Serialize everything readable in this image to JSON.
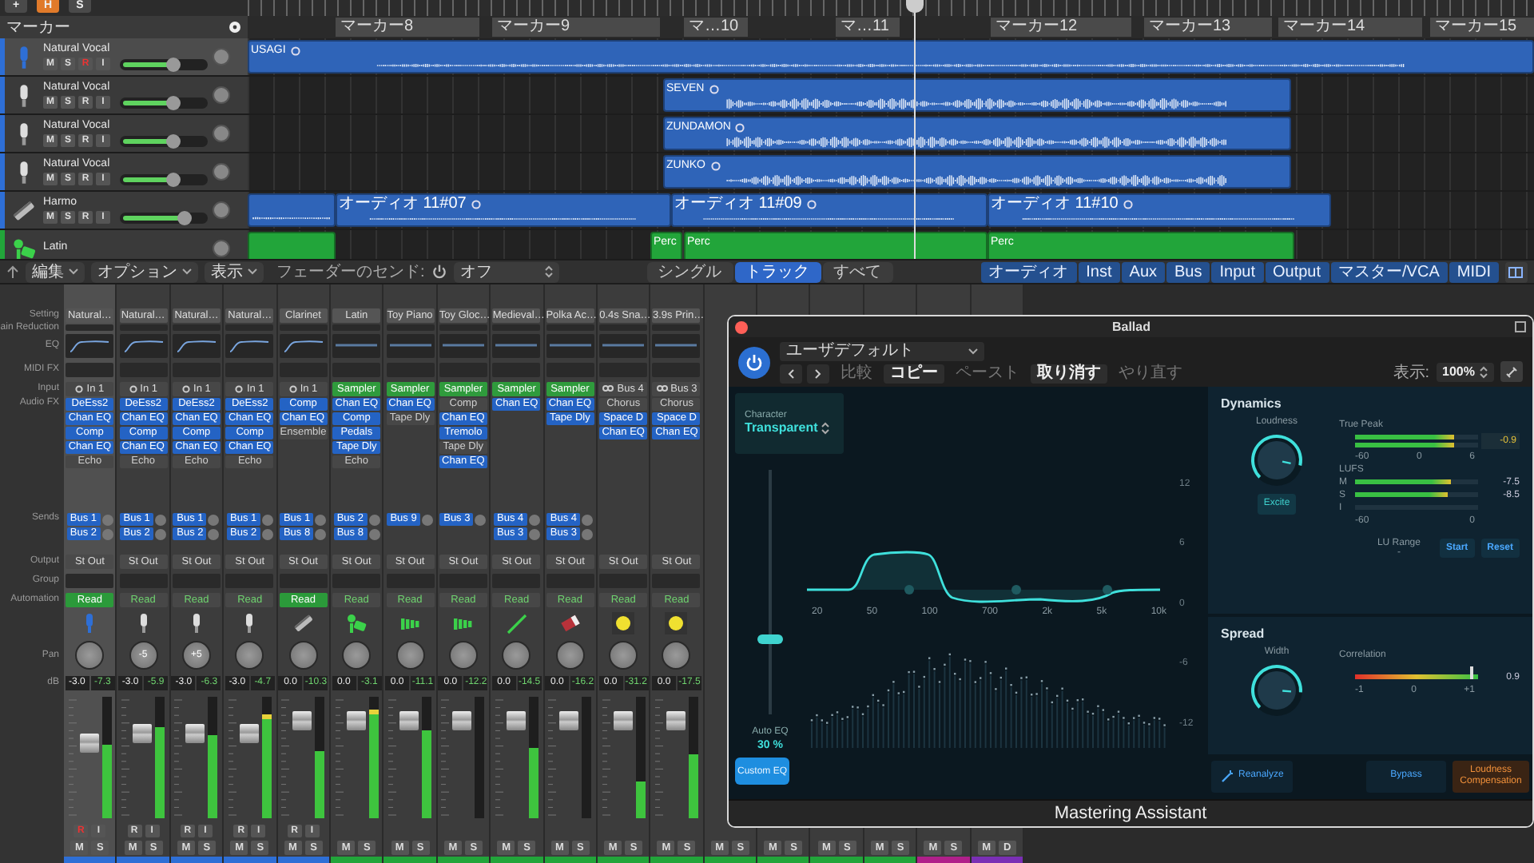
{
  "toolbar": [
    {
      "label": "+",
      "selected": false
    },
    {
      "label": "H",
      "selected": true
    },
    {
      "label": "S",
      "selected": false
    }
  ],
  "markers": {
    "title": "マーカー",
    "items": [
      "マーカー8",
      "マーカー9",
      "マ…10",
      "マ…11",
      "マーカー12",
      "マーカー13",
      "マーカー14",
      "マーカー15"
    ]
  },
  "tracks": [
    {
      "name": "Natural Vocal",
      "kind": "mic-blue",
      "color": "#2e6fd6",
      "selected": true,
      "level": 0.6,
      "buttons": [
        {
          "label": "M",
          "on": false
        },
        {
          "label": "S",
          "on": false
        },
        {
          "label": "R",
          "on": true
        },
        {
          "label": "I",
          "on": false
        }
      ],
      "regions": [
        {
          "kind": "sparse",
          "label": "USAGI"
        }
      ]
    },
    {
      "name": "Natural Vocal",
      "kind": "mic",
      "color": "#2e6fd6",
      "selected": false,
      "level": 0.6,
      "buttons": [
        {
          "label": "M",
          "on": false
        },
        {
          "label": "S",
          "on": false
        },
        {
          "label": "R",
          "on": false
        },
        {
          "label": "I",
          "on": false
        }
      ],
      "regions": [
        {
          "kind": "dense",
          "label": "SEVEN"
        }
      ]
    },
    {
      "name": "Natural Vocal",
      "kind": "mic",
      "color": "#2e6fd6",
      "selected": false,
      "level": 0.6,
      "buttons": [
        {
          "label": "M",
          "on": false
        },
        {
          "label": "S",
          "on": false
        },
        {
          "label": "R",
          "on": false
        },
        {
          "label": "I",
          "on": false
        }
      ],
      "regions": [
        {
          "kind": "dense",
          "label": "ZUNDAMON"
        }
      ]
    },
    {
      "name": "Natural Vocal",
      "kind": "mic",
      "color": "#2e6fd6",
      "selected": false,
      "level": 0.6,
      "buttons": [
        {
          "label": "M",
          "on": false
        },
        {
          "label": "S",
          "on": false
        },
        {
          "label": "R",
          "on": false
        },
        {
          "label": "I",
          "on": false
        }
      ],
      "regions": [
        {
          "kind": "dense",
          "label": "ZUNKO"
        }
      ]
    },
    {
      "name": "Harmo",
      "kind": "harmonica",
      "color": "#2e6fd6",
      "selected": false,
      "level": 0.72,
      "buttons": [
        {
          "label": "M",
          "on": false
        },
        {
          "label": "S",
          "on": false
        },
        {
          "label": "R",
          "on": false
        },
        {
          "label": "I",
          "on": false
        }
      ],
      "regions": [
        {
          "kind": "line"
        },
        {
          "kind": "line",
          "label": "オーディオ 11#07"
        },
        {
          "kind": "line",
          "label": "オーディオ 11#09"
        },
        {
          "kind": "line",
          "label": "オーディオ 11#10"
        }
      ]
    },
    {
      "name": "Latin",
      "kind": "percussion",
      "color": "#22a53a",
      "selected": false,
      "regions": [
        {
          "kind": "midi"
        },
        {
          "kind": "midi",
          "label": "Perc"
        },
        {
          "kind": "midi",
          "label": "Perc"
        },
        {
          "kind": "midi",
          "label": "Perc"
        }
      ]
    }
  ],
  "mixer_toolbar": {
    "menus": [
      "編集",
      "オプション",
      "表示"
    ],
    "send_label": "フェーダーのセンド:",
    "send_value": "オフ",
    "views": [
      {
        "label": "シングル",
        "selected": false
      },
      {
        "label": "トラック",
        "selected": true
      },
      {
        "label": "すべて",
        "selected": false
      }
    ],
    "filters": [
      {
        "label": "オーディオ",
        "selected": true
      },
      {
        "label": "Inst",
        "selected": true
      },
      {
        "label": "Aux",
        "selected": true
      },
      {
        "label": "Bus",
        "selected": true
      },
      {
        "label": "Input",
        "selected": true
      },
      {
        "label": "Output",
        "selected": true
      },
      {
        "label": "マスター/VCA",
        "selected": true
      },
      {
        "label": "MIDI",
        "selected": true
      }
    ]
  },
  "mixer": {
    "row_labels": [
      "Setting",
      "ain Reduction",
      "EQ",
      "MIDI FX",
      "Input",
      "Audio FX",
      "Sends",
      "Output",
      "Group",
      "Automation",
      "Pan",
      "dB"
    ],
    "strips": [
      {
        "setting": "Natural…",
        "selected": true,
        "eq_curve": true,
        "input": {
          "kind": "input",
          "label": "In 1"
        },
        "fx": [
          {
            "label": "DeEss2",
            "on": true
          },
          {
            "label": "Chan EQ",
            "on": true
          },
          {
            "label": "Comp",
            "on": true
          },
          {
            "label": "Chan EQ",
            "on": true
          },
          {
            "label": "Echo",
            "on": false
          }
        ],
        "sends": [
          "Bus 1",
          "Bus 2"
        ],
        "output": "St Out",
        "automation": {
          "label": "Read",
          "active": true
        },
        "kind": "mic-blue",
        "volume": "-3.0",
        "peak": "-7.3",
        "fader": {
          "level": 0.62
        },
        "meter": {
          "level": 0.6
        },
        "buttons": [
          {
            "label": "R",
            "on": true
          },
          {
            "label": "I",
            "on": false
          }
        ],
        "ms": [
          "M",
          "S"
        ],
        "color": "#2e6fd6"
      },
      {
        "setting": "Natural…",
        "selected": false,
        "eq_curve": true,
        "input": {
          "kind": "input",
          "label": "In 1"
        },
        "fx": [
          {
            "label": "DeEss2",
            "on": true
          },
          {
            "label": "Chan EQ",
            "on": true
          },
          {
            "label": "Comp",
            "on": true
          },
          {
            "label": "Chan EQ",
            "on": true
          },
          {
            "label": "Echo",
            "on": false
          }
        ],
        "sends": [
          "Bus 1",
          "Bus 2"
        ],
        "output": "St Out",
        "automation": {
          "label": "Read",
          "active": false
        },
        "kind": "mic",
        "pan": "-5",
        "volume": "-3.0",
        "peak": "-5.9",
        "fader": {
          "level": 0.7
        },
        "meter": {
          "level": 0.75
        },
        "buttons": [
          {
            "label": "R",
            "on": false
          },
          {
            "label": "I",
            "on": false
          }
        ],
        "ms": [
          "M",
          "S"
        ],
        "color": "#2e6fd6"
      },
      {
        "setting": "Natural…",
        "selected": false,
        "eq_curve": true,
        "input": {
          "kind": "input",
          "label": "In 1"
        },
        "fx": [
          {
            "label": "DeEss2",
            "on": true
          },
          {
            "label": "Chan EQ",
            "on": true
          },
          {
            "label": "Comp",
            "on": true
          },
          {
            "label": "Chan EQ",
            "on": true
          },
          {
            "label": "Echo",
            "on": false
          }
        ],
        "sends": [
          "Bus 1",
          "Bus 2"
        ],
        "output": "St Out",
        "automation": {
          "label": "Read",
          "active": false
        },
        "kind": "mic",
        "pan": "+5",
        "volume": "-3.0",
        "peak": "-6.3",
        "fader": {
          "level": 0.7
        },
        "meter": {
          "level": 0.68
        },
        "buttons": [
          {
            "label": "R",
            "on": false
          },
          {
            "label": "I",
            "on": false
          }
        ],
        "ms": [
          "M",
          "S"
        ],
        "color": "#2e6fd6"
      },
      {
        "setting": "Natural…",
        "selected": false,
        "eq_curve": true,
        "input": {
          "kind": "input",
          "label": "In 1"
        },
        "fx": [
          {
            "label": "DeEss2",
            "on": true
          },
          {
            "label": "Chan EQ",
            "on": true
          },
          {
            "label": "Comp",
            "on": true
          },
          {
            "label": "Chan EQ",
            "on": true
          },
          {
            "label": "Echo",
            "on": false
          }
        ],
        "sends": [
          "Bus 1",
          "Bus 2"
        ],
        "output": "St Out",
        "automation": {
          "label": "Read",
          "active": false
        },
        "kind": "mic",
        "volume": "-3.0",
        "peak": "-4.7",
        "fader": {
          "level": 0.7
        },
        "meter": {
          "level": 0.86
        },
        "buttons": [
          {
            "label": "R",
            "on": false
          },
          {
            "label": "I",
            "on": false
          }
        ],
        "ms": [
          "M",
          "S"
        ],
        "color": "#2e6fd6"
      },
      {
        "setting": "Clarinet",
        "selected": false,
        "eq_curve": true,
        "input": {
          "kind": "input",
          "label": "In 1"
        },
        "fx": [
          {
            "label": "Comp",
            "on": true
          },
          {
            "label": "Chan EQ",
            "on": true
          },
          {
            "label": "Ensemble",
            "on": false
          }
        ],
        "sends": [
          "Bus 1",
          "Bus 8"
        ],
        "output": "St Out",
        "automation": {
          "label": "Read",
          "active": true
        },
        "kind": "harmonica",
        "volume": "0.0",
        "peak": "-10.3",
        "fader": {
          "level": 0.8
        },
        "meter": {
          "level": 0.55
        },
        "buttons": [
          {
            "label": "R",
            "on": false
          },
          {
            "label": "I",
            "on": false
          }
        ],
        "ms": [
          "M",
          "S"
        ],
        "color": "#2e6fd6"
      },
      {
        "setting": "Latin",
        "selected": false,
        "eq_curve": false,
        "input": {
          "kind": "instrument",
          "label": "Sampler"
        },
        "fx": [
          {
            "label": "Chan EQ",
            "on": true
          },
          {
            "label": "Comp",
            "on": true
          },
          {
            "label": "Pedals",
            "on": true
          },
          {
            "label": "Tape Dly",
            "on": true
          },
          {
            "label": "Echo",
            "on": false
          }
        ],
        "sends": [
          "Bus 2",
          "Bus 8"
        ],
        "output": "St Out",
        "automation": {
          "label": "Read",
          "active": false
        },
        "kind": "percussion",
        "volume": "0.0",
        "peak": "-3.1",
        "fader": {
          "level": 0.8
        },
        "meter": {
          "level": 0.9
        },
        "ms": [
          "M",
          "S"
        ],
        "color": "#22a53a"
      },
      {
        "setting": "Toy Piano",
        "selected": false,
        "eq_curve": false,
        "input": {
          "kind": "instrument",
          "label": "Sampler"
        },
        "fx": [
          {
            "label": "Chan EQ",
            "on": true
          },
          {
            "label": "Tape Dly",
            "on": false
          }
        ],
        "sends": [
          "Bus 9"
        ],
        "output": "St Out",
        "automation": {
          "label": "Read",
          "active": false
        },
        "kind": "xylophone",
        "volume": "0.0",
        "peak": "-11.1",
        "fader": {
          "level": 0.8
        },
        "meter": {
          "level": 0.72
        },
        "ms": [
          "M",
          "S"
        ],
        "color": "#22a53a"
      },
      {
        "setting": "Toy Gloc…",
        "selected": false,
        "eq_curve": false,
        "input": {
          "kind": "instrument",
          "label": "Sampler"
        },
        "fx": [
          {
            "label": "Comp",
            "on": false
          },
          {
            "label": "Chan EQ",
            "on": true
          },
          {
            "label": "Tremolo",
            "on": true
          },
          {
            "label": "Tape Dly",
            "on": false
          },
          {
            "label": "Chan EQ",
            "on": true
          }
        ],
        "sends": [
          "Bus 3"
        ],
        "output": "St Out",
        "automation": {
          "label": "Read",
          "active": false
        },
        "kind": "xylophone",
        "volume": "0.0",
        "peak": "-12.2",
        "fader": {
          "level": 0.8
        },
        "meter": {
          "level": 0
        },
        "ms": [
          "M",
          "S"
        ],
        "color": "#22a53a"
      },
      {
        "setting": "Medieval…",
        "selected": false,
        "eq_curve": false,
        "input": {
          "kind": "instrument",
          "label": "Sampler"
        },
        "fx": [
          {
            "label": "Chan EQ",
            "on": true
          }
        ],
        "sends": [
          "Bus 4",
          "Bus 3"
        ],
        "output": "St Out",
        "automation": {
          "label": "Read",
          "active": false
        },
        "kind": "flute",
        "volume": "0.0",
        "peak": "-14.5",
        "fader": {
          "level": 0.8
        },
        "meter": {
          "level": 0.58
        },
        "ms": [
          "M",
          "S"
        ],
        "color": "#22a53a"
      },
      {
        "setting": "Polka Ac…",
        "selected": false,
        "eq_curve": false,
        "input": {
          "kind": "instrument",
          "label": "Sampler"
        },
        "fx": [
          {
            "label": "Chan EQ",
            "on": true
          },
          {
            "label": "Tape Dly",
            "on": true
          }
        ],
        "sends": [
          "Bus 4",
          "Bus 3"
        ],
        "output": "St Out",
        "automation": {
          "label": "Read",
          "active": false
        },
        "kind": "accordion",
        "volume": "0.0",
        "peak": "-16.2",
        "fader": {
          "level": 0.8
        },
        "meter": {
          "level": 0
        },
        "ms": [
          "M",
          "S"
        ],
        "color": "#22a53a"
      },
      {
        "setting": "0.4s Sna…",
        "selected": false,
        "eq_curve": false,
        "input": {
          "kind": "bus",
          "label": "Bus 4"
        },
        "fx": [
          {
            "label": "Chorus",
            "on": false
          },
          {
            "label": "Space D",
            "on": true
          },
          {
            "label": "Chan EQ",
            "on": true
          }
        ],
        "output": "St Out",
        "automation": {
          "label": "Read",
          "active": false
        },
        "kind": "dot",
        "volume": "0.0",
        "peak": "-31.2",
        "fader": {
          "level": 0.8
        },
        "meter": {
          "level": 0.3
        },
        "ms": [
          "M",
          "S"
        ],
        "color": "#22a53a"
      },
      {
        "setting": "3.9s Prin…",
        "selected": false,
        "eq_curve": false,
        "input": {
          "kind": "bus",
          "label": "Bus 3"
        },
        "fx": [
          {
            "label": "Chorus",
            "on": false
          },
          {
            "label": "Space D",
            "on": true
          },
          {
            "label": "Chan EQ",
            "on": true
          }
        ],
        "output": "St Out",
        "automation": {
          "label": "Read",
          "active": false
        },
        "kind": "dot",
        "volume": "0.0",
        "peak": "-17.5",
        "fader": {
          "level": 0.8
        },
        "meter": {
          "level": 0.52
        },
        "ms": [
          "M",
          "S"
        ],
        "color": "#22a53a"
      }
    ],
    "covered_strips": [
      {
        "ms": [
          "M",
          "S"
        ],
        "color": "#22a53a"
      },
      {
        "ms": [
          "M",
          "S"
        ],
        "color": "#22a53a"
      },
      {
        "ms": [
          "M",
          "S"
        ],
        "color": "#22a53a"
      },
      {
        "ms": [
          "M",
          "S"
        ],
        "color": "#22a53a"
      },
      {
        "ms": [
          "M",
          "S"
        ],
        "color": "#b0208a"
      },
      {
        "ms": [
          "M",
          "D"
        ],
        "color": "#7a2fb5"
      }
    ]
  },
  "plugin": {
    "title": "Ballad",
    "on": true,
    "preset": "ユーザデフォルト",
    "actions": [
      {
        "label": "比較",
        "enabled": false
      },
      {
        "label": "コピー",
        "enabled": true
      },
      {
        "label": "ペースト",
        "enabled": false
      },
      {
        "label": "取り消す",
        "enabled": true
      },
      {
        "label": "やり直す",
        "enabled": false
      }
    ],
    "zoom_label": "表示:",
    "zoom": "100%",
    "character": {
      "label": "Character",
      "value": "Transparent"
    },
    "eq": {
      "freq_labels": [
        "20",
        "50",
        "100",
        "700",
        "2k",
        "5k",
        "10k"
      ],
      "db_labels": [
        "12",
        "6",
        "0",
        "-6",
        "-12"
      ],
      "auto_eq_label": "Auto EQ",
      "auto_eq_value": "30 %",
      "level": 0.3,
      "custom_eq": "Custom EQ"
    },
    "dynamics": {
      "title": "Dynamics",
      "loudness_label": "Loudness",
      "level": 0.88,
      "excite": "Excite",
      "true_peak": {
        "label": "True Peak",
        "level": 0.8,
        "value": "-0.9",
        "scale": [
          "-60",
          "0",
          "6"
        ]
      },
      "lufs": {
        "label": "LUFS",
        "rows": [
          {
            "label": "M",
            "level": 0.78,
            "value": "-7.5"
          },
          {
            "label": "S",
            "level": 0.75,
            "value": "-8.5"
          },
          {
            "label": "I",
            "level": 0
          }
        ],
        "scale": [
          "-60",
          "0"
        ]
      },
      "lu_range": {
        "label": "LU Range",
        "value": "-"
      },
      "buttons": [
        "Start",
        "Reset"
      ]
    },
    "spread": {
      "title": "Spread",
      "width_label": "Width",
      "level": 0.85,
      "correlation": {
        "label": "Correlation",
        "level": 0.95,
        "value": "0.9",
        "scale": [
          "-1",
          "0",
          "+1"
        ]
      }
    },
    "footer": {
      "reanalyze": "Reanalyze",
      "bypass": "Bypass",
      "compensation": "Loudness Compensation"
    },
    "caption": "Mastering Assistant"
  }
}
